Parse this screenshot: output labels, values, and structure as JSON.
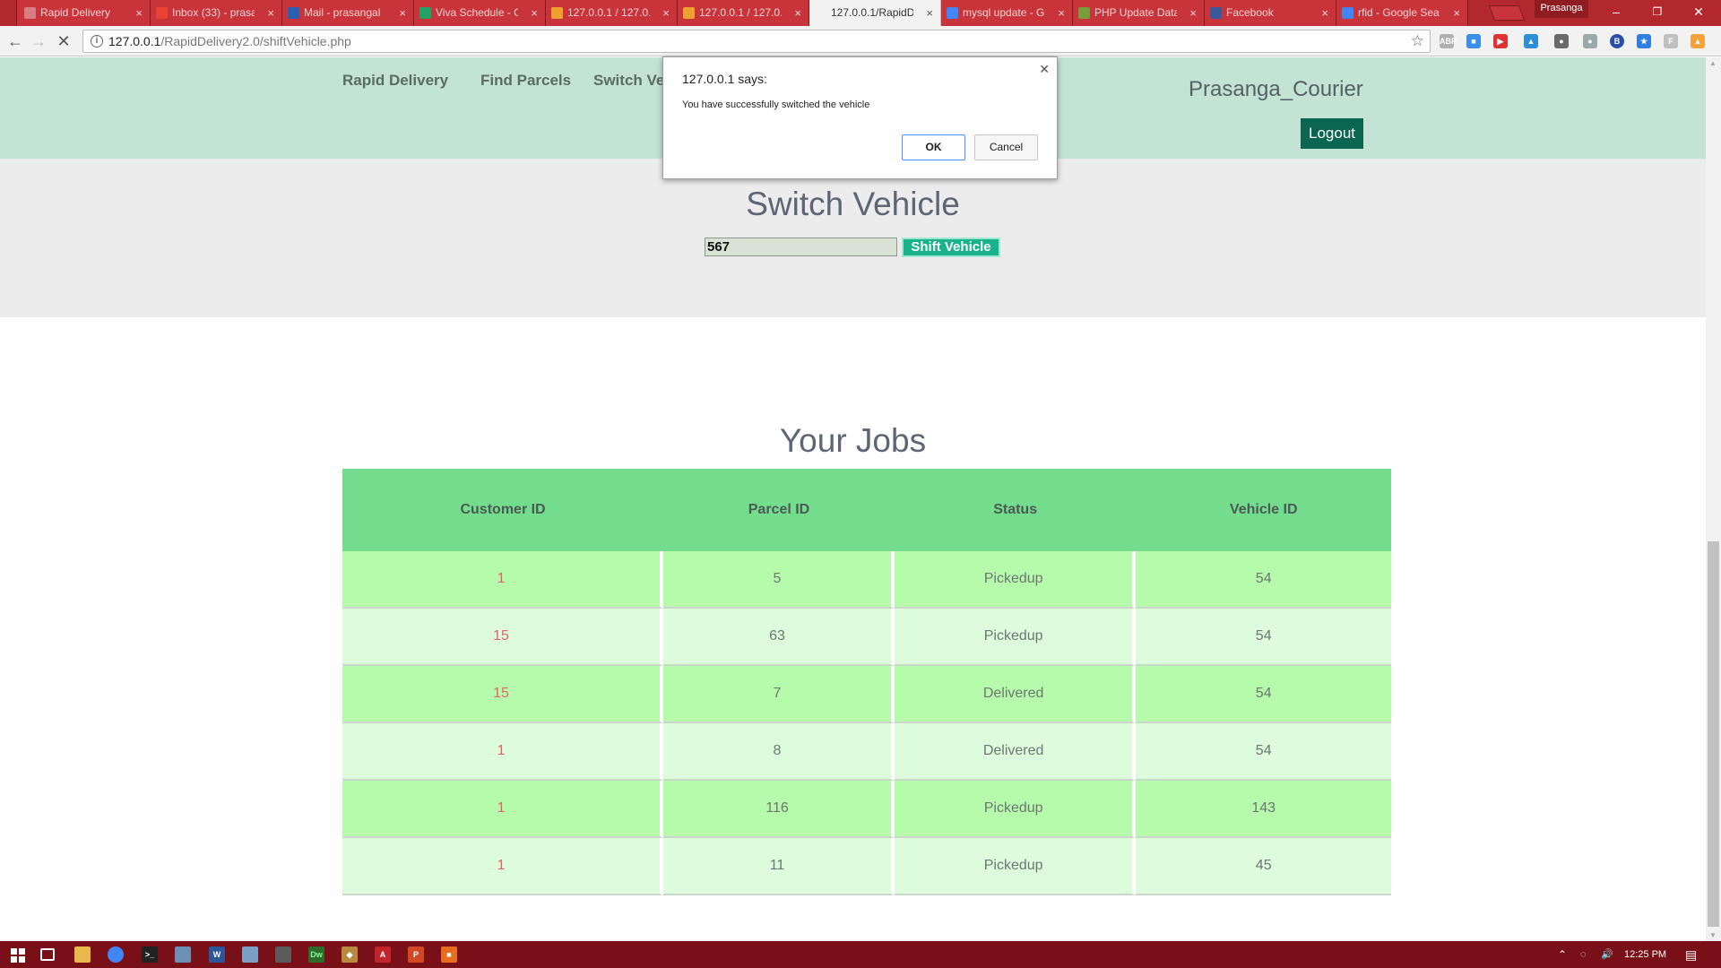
{
  "browser": {
    "tabs": [
      {
        "title": "Rapid Delivery",
        "favicon": "page-icon",
        "color": "#d77d83",
        "active": false
      },
      {
        "title": "Inbox (33) - prasa",
        "favicon": "gmail-icon",
        "color": "#ea4335",
        "active": false
      },
      {
        "title": "Mail - prasangal",
        "favicon": "outlook-icon",
        "color": "#2b5fb4",
        "active": false
      },
      {
        "title": "Viva Schedule - G",
        "favicon": "sheets-icon",
        "color": "#21a366",
        "active": false
      },
      {
        "title": "127.0.0.1 / 127.0.",
        "favicon": "phpmyadmin-icon",
        "color": "#f0a030",
        "active": false
      },
      {
        "title": "127.0.0.1 / 127.0.",
        "favicon": "phpmyadmin-icon",
        "color": "#f0a030",
        "active": false
      },
      {
        "title": "127.0.0.1/RapidD",
        "favicon": "none",
        "color": "#f2f2f2",
        "active": true
      },
      {
        "title": "mysql update - G",
        "favicon": "google-icon",
        "color": "#4285f4",
        "active": false
      },
      {
        "title": "PHP Update Data",
        "favicon": "w3schools-icon",
        "color": "#7a9b3a",
        "active": false
      },
      {
        "title": "Facebook",
        "favicon": "facebook-icon",
        "color": "#3b5998",
        "active": false
      },
      {
        "title": "rfid - Google Sea",
        "favicon": "google-icon",
        "color": "#4285f4",
        "active": false
      }
    ],
    "profile_name": "Prasanga",
    "url_host": "127.0.0.1",
    "url_path": "/RapidDelivery2.0/shiftVehicle.php",
    "window_controls": {
      "minimize": "–",
      "restore": "❐",
      "close": "✕"
    }
  },
  "site": {
    "nav": [
      "Rapid Delivery",
      "Find Parcels",
      "Switch Vehicle"
    ],
    "user_name": "Prasanga_Courier",
    "logout_label": "Logout",
    "switch_title": "Switch Vehicle",
    "vehicle_input_value": "567",
    "shift_button_label": "Shift Vehicle",
    "jobs_title": "Your Jobs",
    "jobs_headers": [
      "Customer ID",
      "Parcel ID",
      "Status",
      "Vehicle ID"
    ],
    "jobs_rows": [
      [
        "1",
        "5",
        "Pickedup",
        "54"
      ],
      [
        "15",
        "63",
        "Pickedup",
        "54"
      ],
      [
        "15",
        "7",
        "Delivered",
        "54"
      ],
      [
        "1",
        "8",
        "Delivered",
        "54"
      ],
      [
        "1",
        "116",
        "Pickedup",
        "143"
      ],
      [
        "1",
        "11",
        "Pickedup",
        "45"
      ]
    ]
  },
  "dialog": {
    "title": "127.0.0.1 says:",
    "message": "You have successfully switched the vehicle",
    "ok_label": "OK",
    "cancel_label": "Cancel"
  },
  "taskbar": {
    "clock": "12:25 PM"
  }
}
